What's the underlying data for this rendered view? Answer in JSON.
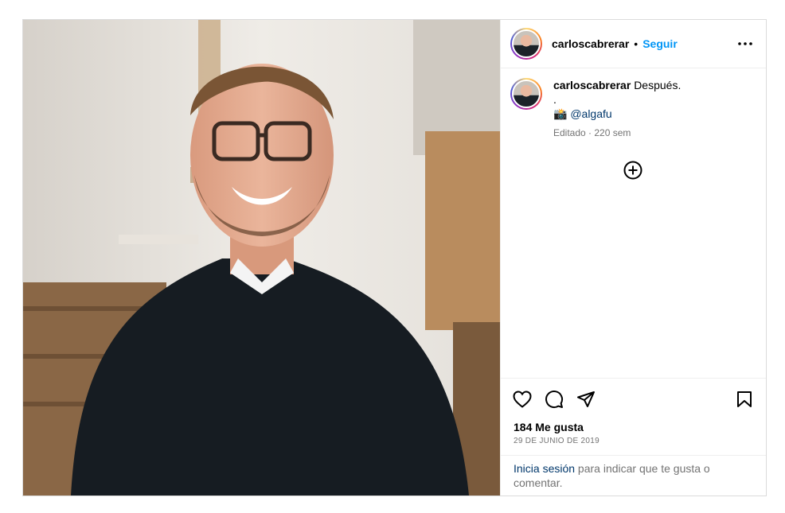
{
  "post": {
    "username": "carloscabrerar",
    "follow_label": "Seguir",
    "separator": "•",
    "caption": {
      "text": "Después.",
      "line2": ".",
      "mention_emoji": "📸",
      "mention": "@algafu"
    },
    "meta": "Editado · 220 sem",
    "likes": "184 Me gusta",
    "date": "29 de junio de 2019",
    "login_link": "Inicia sesión",
    "login_rest": " para indicar que te gusta o comentar."
  },
  "icons": [
    "more-options-icon",
    "add-comment-icon",
    "like-icon",
    "comment-icon",
    "share-icon",
    "save-icon"
  ],
  "colors": {
    "link_blue": "#0095f6",
    "mention": "#00376b",
    "muted": "#737373",
    "border": "#dbdbdb"
  }
}
